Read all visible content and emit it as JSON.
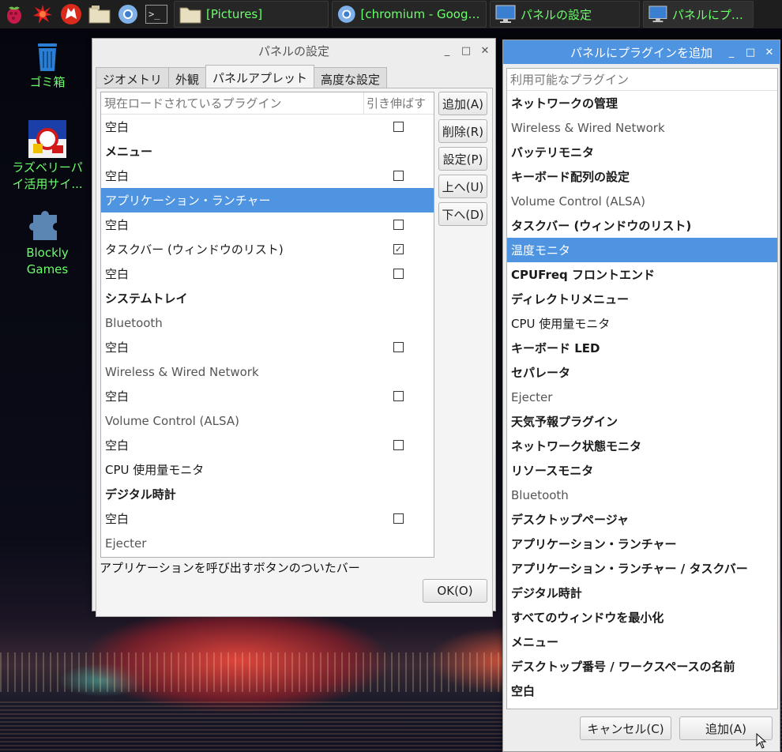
{
  "taskbar": {
    "launchers": [
      {
        "name": "raspberry-icon"
      },
      {
        "name": "burst-icon"
      },
      {
        "name": "wolfram-icon"
      },
      {
        "name": "file-manager-icon"
      },
      {
        "name": "chromium-icon"
      },
      {
        "name": "terminal-icon",
        "label": ">_"
      }
    ],
    "tasks": [
      {
        "label": "[Pictures]",
        "icon": "folder-icon"
      },
      {
        "label": "[chromium - Google ...",
        "icon": "chromium-icon"
      },
      {
        "label": "パネルの設定",
        "icon": "monitor-icon"
      },
      {
        "label": "パネルにプラグ",
        "icon": "monitor-icon"
      }
    ]
  },
  "desktop": {
    "icons": [
      {
        "label": "ゴミ箱",
        "icon": "trash-icon"
      },
      {
        "label1": "ラズベリーパ",
        "label2": "イ活用サイ...",
        "icon": "app-icon"
      },
      {
        "label1": "Blockly",
        "label2": "Games",
        "icon": "puzzle-icon"
      }
    ]
  },
  "panel_settings": {
    "title": "パネルの設定",
    "tabs": [
      "ジオメトリ",
      "外観",
      "パネルアプレット",
      "高度な設定"
    ],
    "list_header": {
      "plugins": "現在ロードされているプラグイン",
      "stretch": "引き伸ばす"
    },
    "rows": [
      {
        "label": "空白",
        "style": "normal",
        "checkbox": "unchecked"
      },
      {
        "label": "メニュー",
        "style": "bold",
        "checkbox": "none"
      },
      {
        "label": "空白",
        "style": "normal",
        "checkbox": "unchecked"
      },
      {
        "label": "アプリケーション・ランチャー",
        "style": "normal",
        "checkbox": "none",
        "selected": true
      },
      {
        "label": "空白",
        "style": "normal",
        "checkbox": "unchecked"
      },
      {
        "label": "タスクバー (ウィンドウのリスト)",
        "style": "normal",
        "checkbox": "checked"
      },
      {
        "label": "空白",
        "style": "normal",
        "checkbox": "unchecked"
      },
      {
        "label": "システムトレイ",
        "style": "bold",
        "checkbox": "none"
      },
      {
        "label": "Bluetooth",
        "style": "light",
        "checkbox": "none"
      },
      {
        "label": "空白",
        "style": "normal",
        "checkbox": "unchecked"
      },
      {
        "label": "Wireless & Wired Network",
        "style": "light",
        "checkbox": "none"
      },
      {
        "label": "空白",
        "style": "normal",
        "checkbox": "unchecked"
      },
      {
        "label": "Volume Control (ALSA)",
        "style": "light",
        "checkbox": "none"
      },
      {
        "label": "空白",
        "style": "normal",
        "checkbox": "unchecked"
      },
      {
        "label": "CPU 使用量モニタ",
        "style": "normal",
        "checkbox": "none"
      },
      {
        "label": "デジタル時計",
        "style": "bold",
        "checkbox": "none"
      },
      {
        "label": "空白",
        "style": "normal",
        "checkbox": "unchecked"
      },
      {
        "label": "Ejecter",
        "style": "light",
        "checkbox": "none"
      }
    ],
    "buttons": {
      "add": "追加(A)",
      "remove": "削除(R)",
      "settings": "設定(P)",
      "up": "上へ(U)",
      "down": "下へ(D)"
    },
    "description": "アプリケーションを呼び出すボタンのついたバー",
    "ok": "OK(O)"
  },
  "add_plugin": {
    "title": "パネルにプラグインを追加",
    "list_header": "利用可能なプラグイン",
    "items": [
      {
        "label": "ネットワークの管理",
        "style": "bold"
      },
      {
        "label": "Wireless & Wired Network",
        "style": "light"
      },
      {
        "label": "バッテリモニタ",
        "style": "bold"
      },
      {
        "label": "キーボード配列の設定",
        "style": "bold"
      },
      {
        "label": "Volume Control (ALSA)",
        "style": "light"
      },
      {
        "label": "タスクバー (ウィンドウのリスト)",
        "style": "bold"
      },
      {
        "label": "温度モニタ",
        "style": "normal",
        "selected": true
      },
      {
        "label": "CPUFreq フロントエンド",
        "style": "bold"
      },
      {
        "label": "ディレクトリメニュー",
        "style": "bold"
      },
      {
        "label": "CPU 使用量モニタ",
        "style": "normal"
      },
      {
        "label": "キーボード LED",
        "style": "bold"
      },
      {
        "label": "セパレータ",
        "style": "bold"
      },
      {
        "label": "Ejecter",
        "style": "light"
      },
      {
        "label": "天気予報プラグイン",
        "style": "bold"
      },
      {
        "label": "ネットワーク状態モニタ",
        "style": "bold"
      },
      {
        "label": "リソースモニタ",
        "style": "bold"
      },
      {
        "label": "Bluetooth",
        "style": "light"
      },
      {
        "label": "デスクトップページャ",
        "style": "bold"
      },
      {
        "label": "アプリケーション・ランチャー",
        "style": "bold"
      },
      {
        "label": "アプリケーション・ランチャー / タスクバー",
        "style": "bold"
      },
      {
        "label": "デジタル時計",
        "style": "bold"
      },
      {
        "label": "すべてのウィンドウを最小化",
        "style": "bold"
      },
      {
        "label": "メニュー",
        "style": "bold"
      },
      {
        "label": "デスクトップ番号 / ワークスペースの名前",
        "style": "bold"
      },
      {
        "label": "空白",
        "style": "bold"
      }
    ],
    "cancel": "キャンセル(C)",
    "add": "追加(A)"
  },
  "window_controls": {
    "minimize": "_",
    "maximize": "□",
    "close": "✕"
  }
}
